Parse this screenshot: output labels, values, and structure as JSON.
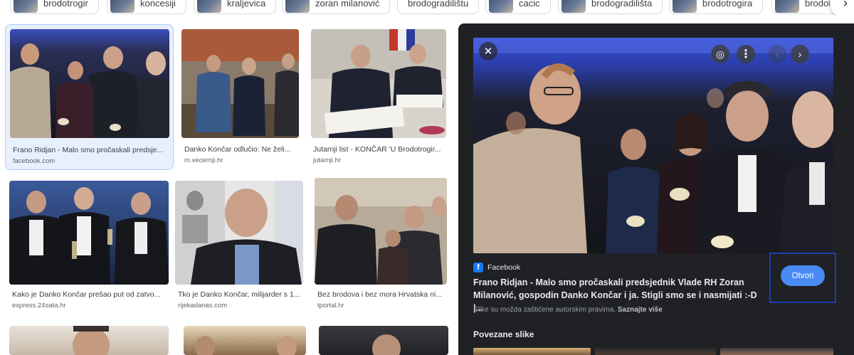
{
  "chips": [
    {
      "label": "brodotrogir"
    },
    {
      "label": "koncesiji"
    },
    {
      "label": "kraljevica"
    },
    {
      "label": "zoran milanović"
    },
    {
      "label": "brodogradilištu"
    },
    {
      "label": "cacic"
    },
    {
      "label": "brodogradilišta"
    },
    {
      "label": "brodotrogira"
    },
    {
      "label": "brodotr"
    }
  ],
  "results": [
    {
      "title": "Frano Ridjan - Malo smo pročaskali predsje...",
      "source": "facebook.com"
    },
    {
      "title": "Danko Končar odlučio: Ne želi...",
      "source": "m.vecernji.hr"
    },
    {
      "title": "Jutarnji list - KONČAR 'U Brodotrogir...",
      "source": "jutarnji.hr"
    },
    {
      "title": "Kako je Danko Končar prešao put od zatvo...",
      "source": "express.24sata.hr"
    },
    {
      "title": "Tko je Danko Končar, milijarder s 1...",
      "source": "rijekadanas.com"
    },
    {
      "title": "Bez brodova i bez mora Hrvatska ni...",
      "source": "tportal.hr"
    }
  ],
  "panel": {
    "source_name": "Facebook",
    "title": "Frano Ridjan - Malo smo pročaskali predsjednik Vlade RH Zoran Milanović, gospodin Danko Končar i ja. Stigli smo se i nasmijati :-D |...",
    "copyright": "Slike su možda zaštićene autorskim pravima.",
    "learn_more": "Saznajte više",
    "open_label": "Otvori",
    "related_heading": "Povezane slike"
  },
  "icons": {
    "close": "close-icon",
    "lens": "lens-icon",
    "more": "more-vert-icon",
    "prev": "chevron-left-icon",
    "next": "chevron-right-icon",
    "facebook": "facebook-icon"
  }
}
